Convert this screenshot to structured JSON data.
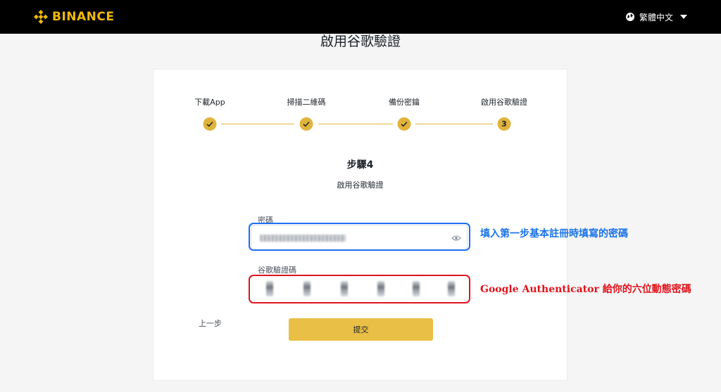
{
  "header": {
    "brand": "BINANCE",
    "language": "繁體中文",
    "brand_color": "#f0b90b"
  },
  "page_title": "啟用谷歌驗證",
  "steps": [
    {
      "label": "下載App",
      "state": "done",
      "marker": ""
    },
    {
      "label": "掃描二維碼",
      "state": "done",
      "marker": ""
    },
    {
      "label": "備份密鑰",
      "state": "done",
      "marker": ""
    },
    {
      "label": "啟用谷歌驗證",
      "state": "current",
      "marker": "3"
    }
  ],
  "step_heading": "步驟4",
  "step_subheading": "啟用谷歌驗證",
  "password": {
    "label": "密碼",
    "value_obscured": true,
    "icon": "eye-icon"
  },
  "auth_code": {
    "label": "谷歌驗證碼",
    "digits": 6,
    "value_obscured": true
  },
  "actions": {
    "back_label": "上一步",
    "submit_label": "提交"
  },
  "annotations": {
    "password_note": "填入第一步基本註冊時填寫的密碼",
    "code_note": "Google Authenticator 給你的六位動態密碼",
    "password_color": "#1a73e8",
    "code_color": "#e0131c"
  }
}
